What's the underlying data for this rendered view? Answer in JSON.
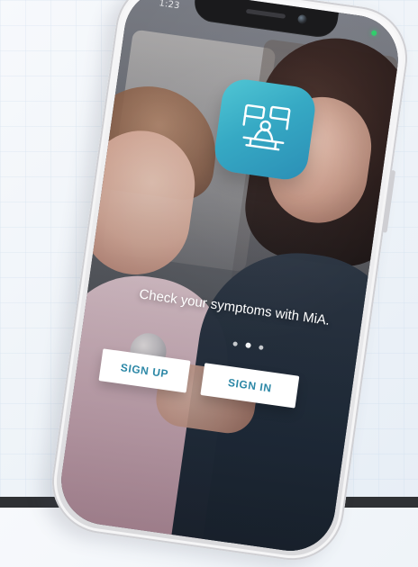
{
  "status_bar": {
    "time": "1:23"
  },
  "app": {
    "icon_name": "clinic-desk-icon",
    "accent_color": "#36a9c4"
  },
  "onboarding": {
    "tagline": "Check your symptoms with MiA.",
    "pager_dots": 3,
    "active_dot_index": 1,
    "sign_up_label": "SIGN UP",
    "sign_in_label": "SIGN IN"
  }
}
